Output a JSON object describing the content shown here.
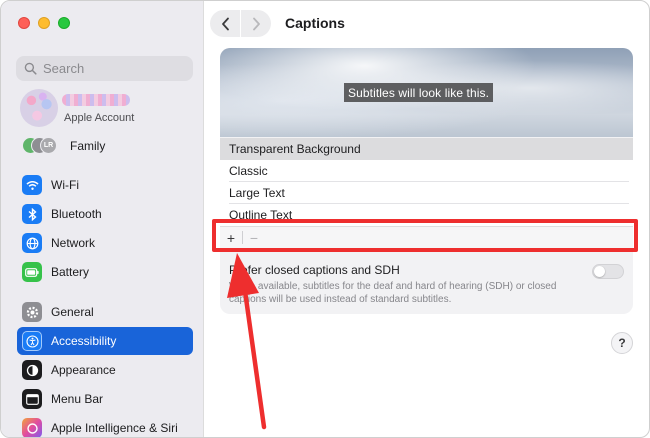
{
  "sidebar": {
    "search_placeholder": "Search",
    "account_label": "Apple Account",
    "family_label": "Family",
    "family_avatars": [
      "",
      "",
      "LR"
    ],
    "items": [
      {
        "label": "Wi-Fi",
        "icon": "wifi-icon",
        "color": "#1a7cf5"
      },
      {
        "label": "Bluetooth",
        "icon": "bluetooth-icon",
        "color": "#1a7cf5"
      },
      {
        "label": "Network",
        "icon": "globe-icon",
        "color": "#1a7cf5"
      },
      {
        "label": "Battery",
        "icon": "battery-icon",
        "color": "#36c24a"
      },
      {
        "label": "General",
        "icon": "gear-icon",
        "color": "#8e8e93"
      },
      {
        "label": "Accessibility",
        "icon": "accessibility-icon",
        "color": "#1a7cf5"
      },
      {
        "label": "Appearance",
        "icon": "appearance-icon",
        "color": "#1c1c1e"
      },
      {
        "label": "Menu Bar",
        "icon": "menu-bar-icon",
        "color": "#1c1c1e"
      },
      {
        "label": "Apple Intelligence & Siri",
        "icon": "siri-icon",
        "color": "#d05fd8"
      }
    ],
    "active_item": "Accessibility"
  },
  "header": {
    "title": "Captions"
  },
  "preview": {
    "sample_text": "Subtitles will look like this."
  },
  "styles": {
    "items": [
      "Transparent Background",
      "Classic",
      "Large Text",
      "Outline Text"
    ],
    "selected": "Transparent Background",
    "add_label": "+",
    "remove_label": "−"
  },
  "setting": {
    "title": "Prefer closed captions and SDH",
    "description": "When available, subtitles for the deaf and hard of hearing (SDH) or closed captions will be used instead of standard subtitles.",
    "enabled": false
  },
  "help_label": "?",
  "colors": {
    "accent": "#1964d9",
    "highlight": "#ee2e2e"
  }
}
